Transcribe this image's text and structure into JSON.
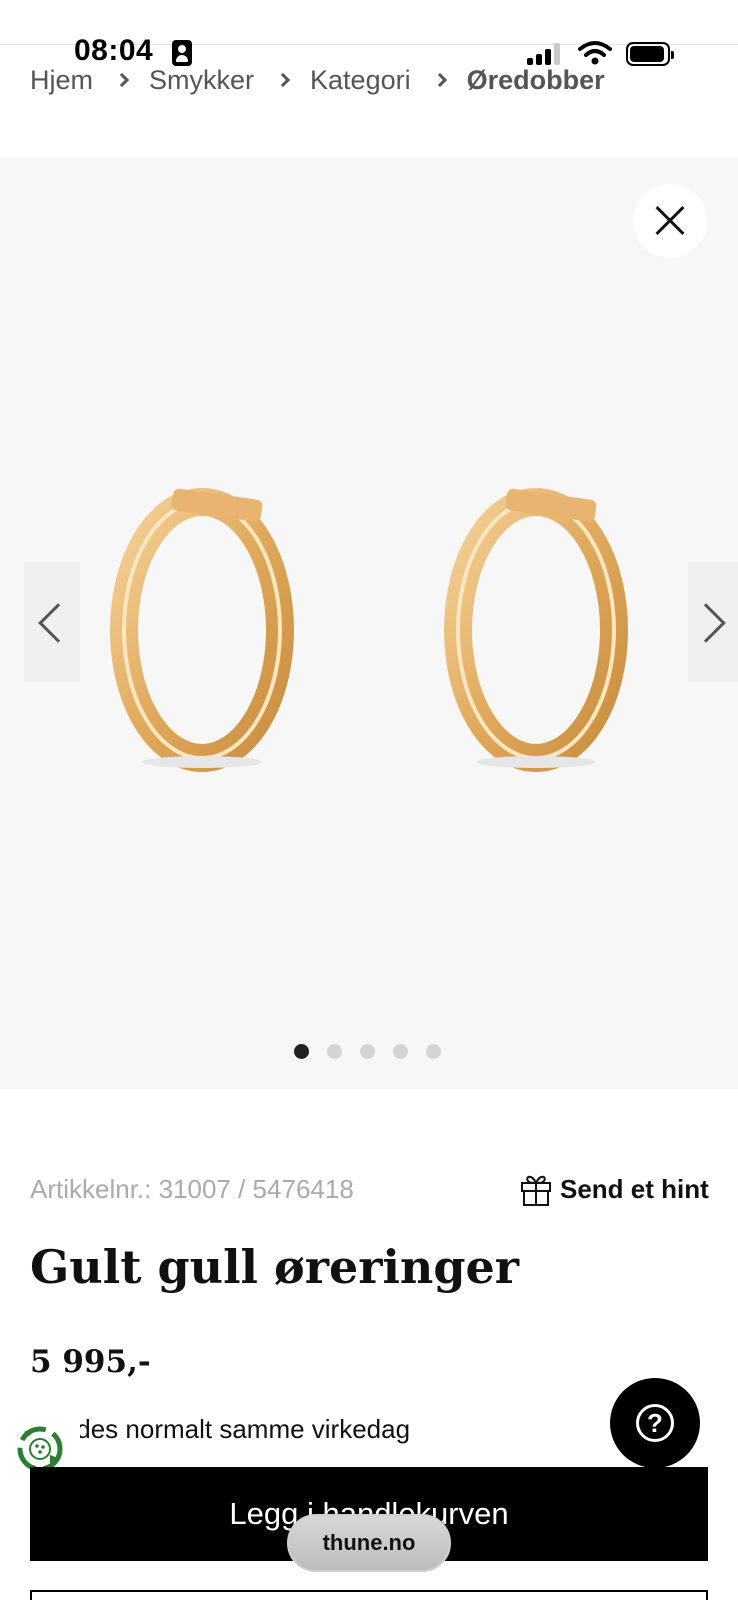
{
  "status_bar": {
    "time": "08:04"
  },
  "breadcrumb": {
    "items": [
      "Hjem",
      "Smykker",
      "Kategori",
      "Øredobber"
    ]
  },
  "gallery": {
    "image_count": 5,
    "active_index": 0
  },
  "product": {
    "sku": "Artikkelnr.: 31007 / 5476418",
    "hint_label": "Send et hint",
    "title": "Gult gull øreringer",
    "price": "5 995,-",
    "delivery": "Sendes normalt samme virkedag"
  },
  "actions": {
    "add_to_cart": "Legg i handlekurven",
    "help": "?"
  },
  "browser": {
    "url": "thune.no"
  },
  "colors": {
    "gold": "#e6b36a",
    "gallery_bg": "#f7f7f7",
    "button_bg": "#000000",
    "badge_green": "#2e7d32"
  }
}
